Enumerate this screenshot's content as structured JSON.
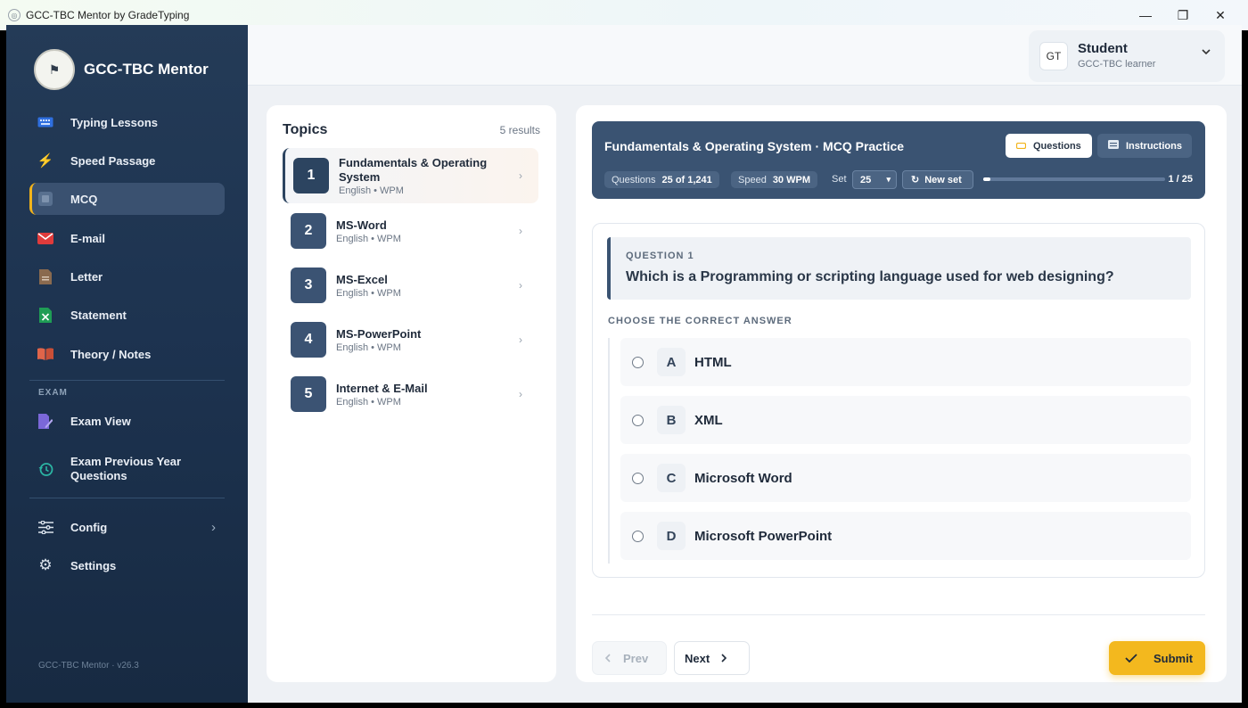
{
  "window": {
    "title": "GCC-TBC Mentor by GradeTyping",
    "minimize": "—",
    "maximize": "❐",
    "close": "✕"
  },
  "brand": {
    "name": "GCC-TBC Mentor"
  },
  "nav": {
    "items": [
      {
        "label": "Typing Lessons",
        "icon": "keyboard-icon"
      },
      {
        "label": "Speed Passage",
        "icon": "lightning-icon"
      },
      {
        "label": "MCQ",
        "icon": "mcq-icon"
      },
      {
        "label": "E-mail",
        "icon": "envelope-icon"
      },
      {
        "label": "Letter",
        "icon": "document-icon"
      },
      {
        "label": "Statement",
        "icon": "spreadsheet-icon"
      },
      {
        "label": "Theory / Notes",
        "icon": "book-icon"
      }
    ],
    "exam_heading": "EXAM",
    "exam_items": [
      {
        "label": "Exam View",
        "icon": "pencil-doc-icon"
      },
      {
        "label": "Exam Previous Year Questions",
        "icon": "history-icon"
      }
    ],
    "config": {
      "label": "Config",
      "icon": "sliders-icon",
      "chevron": "›"
    },
    "settings": {
      "label": "Settings",
      "icon": "gear-icon"
    },
    "version": "GCC-TBC Mentor · v26.3"
  },
  "profile": {
    "initials": "GT",
    "name": "Student",
    "role": "GCC-TBC learner"
  },
  "topics": {
    "title": "Topics",
    "count": "5 results",
    "items": [
      {
        "num": "1",
        "name": "Fundamentals & Operating System",
        "sub": "English • WPM"
      },
      {
        "num": "2",
        "name": "MS-Word",
        "sub": "English • WPM"
      },
      {
        "num": "3",
        "name": "MS-Excel",
        "sub": "English • WPM"
      },
      {
        "num": "4",
        "name": "MS-PowerPoint",
        "sub": "English • WPM"
      },
      {
        "num": "5",
        "name": "Internet & E-Mail",
        "sub": "English • WPM"
      }
    ]
  },
  "practice": {
    "title": "Fundamentals & Operating System · MCQ Practice",
    "tab_questions": "Questions",
    "tab_instructions": "Instructions",
    "questions_label": "Questions",
    "questions_value": "25 of 1,241",
    "speed_label": "Speed",
    "speed_value": "30 WPM",
    "set_label": "Set",
    "set_value": "25",
    "new_set": "New set",
    "progress_text": "1 / 25",
    "progress_fraction": 0.04
  },
  "question": {
    "number_label": "QUESTION 1",
    "text": "Which is a Programming or scripting language used for web designing?",
    "choose_label": "CHOOSE THE CORRECT ANSWER",
    "options": [
      {
        "letter": "A",
        "text": "HTML"
      },
      {
        "letter": "B",
        "text": "XML"
      },
      {
        "letter": "C",
        "text": "Microsoft Word"
      },
      {
        "letter": "D",
        "text": "Microsoft PowerPoint"
      }
    ]
  },
  "actions": {
    "prev": "Prev",
    "next": "Next",
    "submit": "Submit"
  },
  "colors": {
    "sidebar": "#1d3350",
    "accent": "#f3b81e",
    "hero": "#3a5372"
  }
}
